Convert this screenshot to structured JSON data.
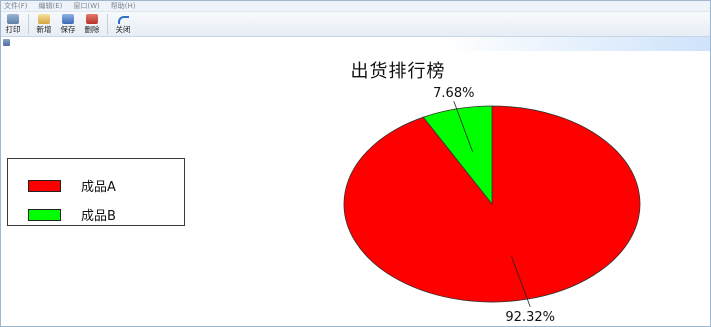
{
  "menu": {
    "items": [
      "文件(F)",
      "编辑(E)",
      "窗口(W)",
      "帮助(H)"
    ]
  },
  "toolbar": {
    "buttons": [
      {
        "label": "打印",
        "icon": "print-icon"
      },
      {
        "label": "新增",
        "icon": "new-icon"
      },
      {
        "label": "保存",
        "icon": "save-icon"
      },
      {
        "label": "删除",
        "icon": "delete-icon"
      },
      {
        "label": "关闭",
        "icon": "close-icon"
      }
    ]
  },
  "chart_data": {
    "type": "pie",
    "title": "出货排行榜",
    "slices": [
      {
        "name": "成品A",
        "value": 92.32,
        "label": "92.32%",
        "color": "#ff0000"
      },
      {
        "name": "成品B",
        "value": 7.68,
        "label": "7.68%",
        "color": "#00ff00"
      }
    ],
    "legend": {
      "placement": "left",
      "entries": [
        "成品A",
        "成品B"
      ]
    }
  }
}
